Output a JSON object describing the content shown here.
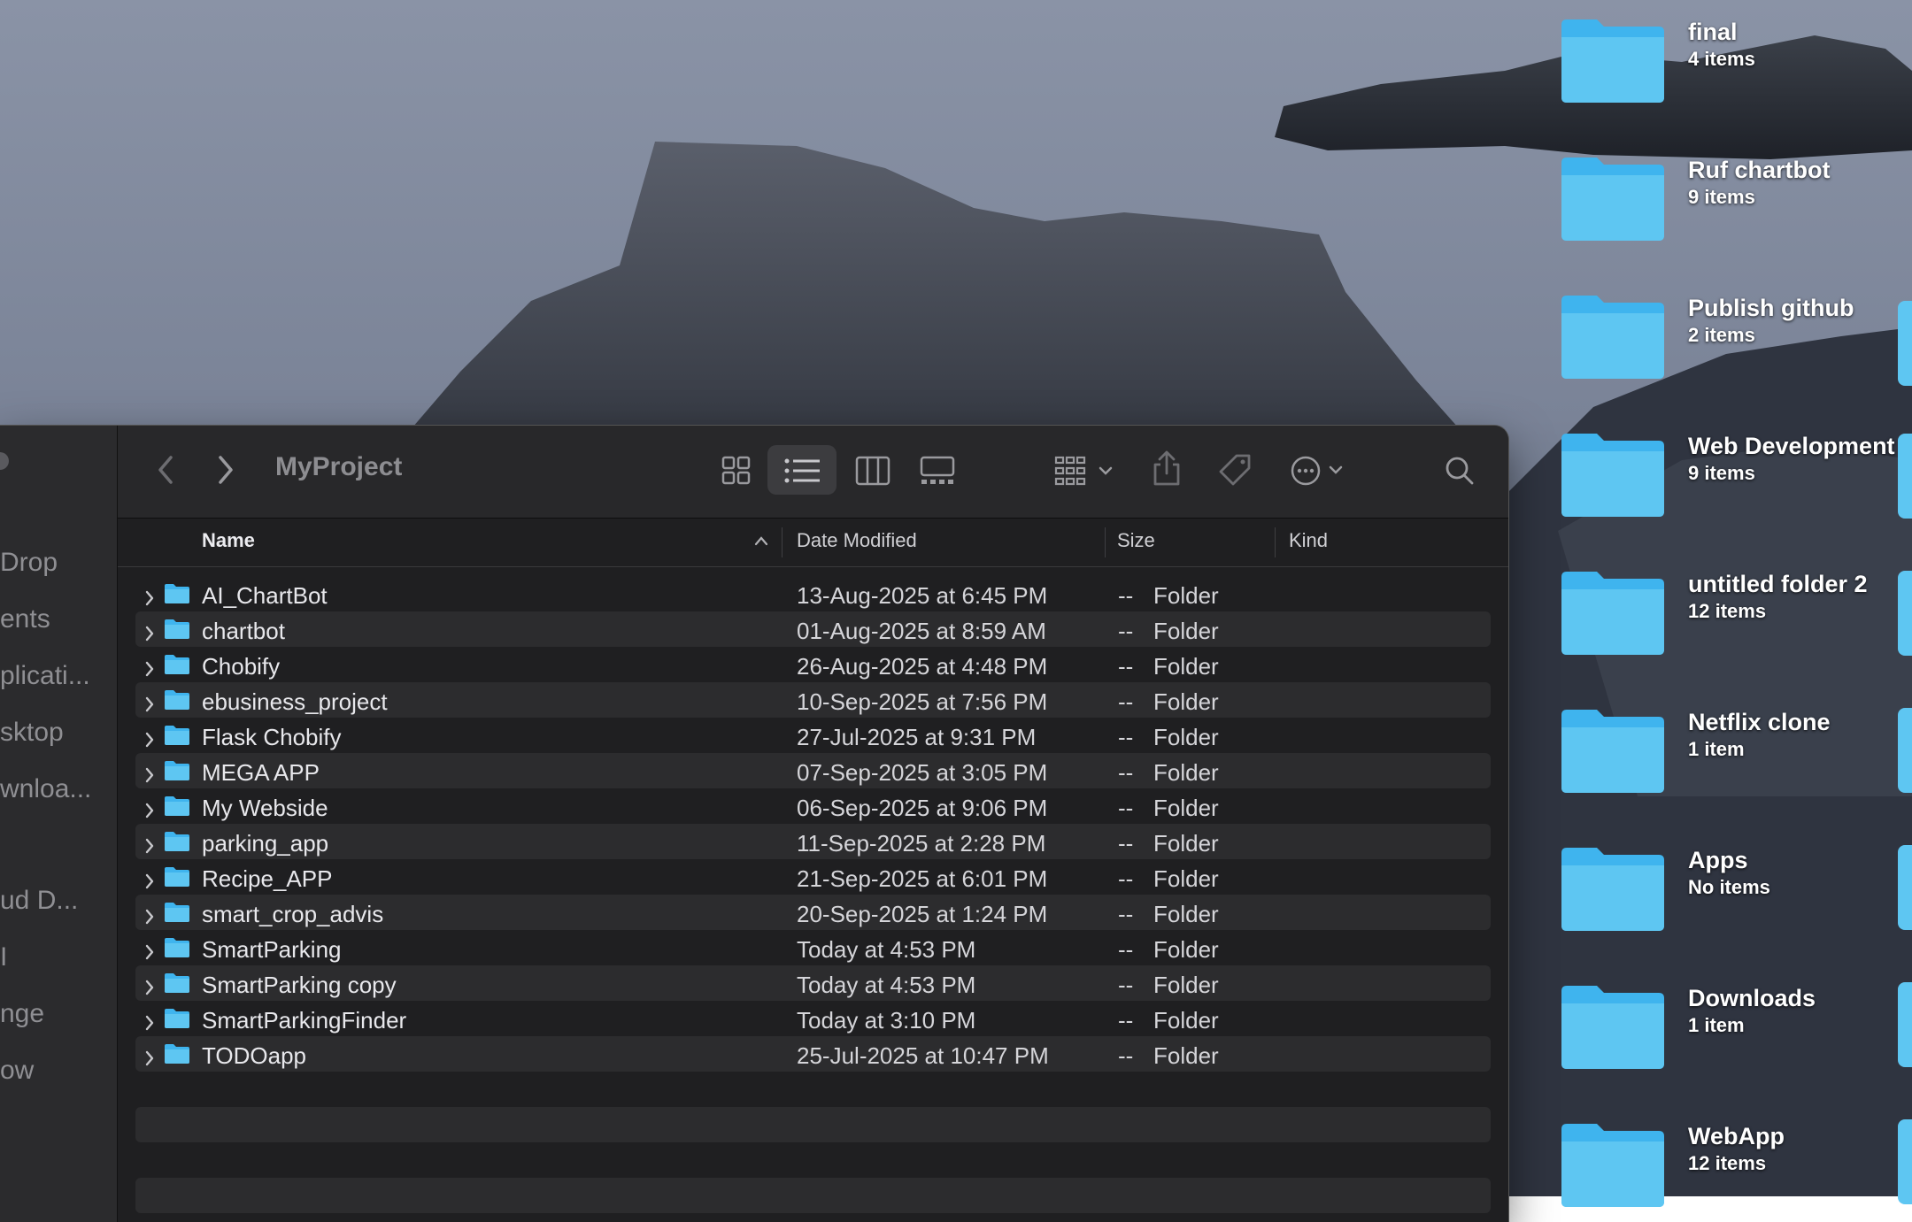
{
  "finder": {
    "title": "MyProject",
    "sidebar_items": [
      "Drop",
      "ents",
      "plicati...",
      "sktop",
      "wnloa...",
      "ud D...",
      "I",
      "nge",
      "ow"
    ],
    "columns": {
      "name": "Name",
      "date": "Date Modified",
      "size": "Size",
      "kind": "Kind"
    },
    "rows": [
      {
        "name": "AI_ChartBot",
        "date": "13-Aug-2025 at 6:45 PM",
        "size": "--",
        "kind": "Folder"
      },
      {
        "name": "chartbot",
        "date": "01-Aug-2025 at 8:59 AM",
        "size": "--",
        "kind": "Folder"
      },
      {
        "name": "Chobify",
        "date": "26-Aug-2025 at 4:48 PM",
        "size": "--",
        "kind": "Folder"
      },
      {
        "name": "ebusiness_project",
        "date": "10-Sep-2025 at 7:56 PM",
        "size": "--",
        "kind": "Folder"
      },
      {
        "name": "Flask Chobify",
        "date": "27-Jul-2025 at 9:31 PM",
        "size": "--",
        "kind": "Folder"
      },
      {
        "name": "MEGA APP",
        "date": "07-Sep-2025 at 3:05 PM",
        "size": "--",
        "kind": "Folder"
      },
      {
        "name": "My Webside",
        "date": "06-Sep-2025 at 9:06 PM",
        "size": "--",
        "kind": "Folder"
      },
      {
        "name": "parking_app",
        "date": "11-Sep-2025 at 2:28 PM",
        "size": "--",
        "kind": "Folder"
      },
      {
        "name": "Recipe_APP",
        "date": "21-Sep-2025 at 6:01 PM",
        "size": "--",
        "kind": "Folder"
      },
      {
        "name": "smart_crop_advis",
        "date": "20-Sep-2025 at 1:24 PM",
        "size": "--",
        "kind": "Folder"
      },
      {
        "name": "SmartParking",
        "date": "Today at 4:53 PM",
        "size": "--",
        "kind": "Folder"
      },
      {
        "name": "SmartParking copy",
        "date": "Today at 4:53 PM",
        "size": "--",
        "kind": "Folder"
      },
      {
        "name": "SmartParkingFinder",
        "date": "Today at 3:10 PM",
        "size": "--",
        "kind": "Folder"
      },
      {
        "name": "TODOapp",
        "date": "25-Jul-2025 at 10:47 PM",
        "size": "--",
        "kind": "Folder"
      }
    ]
  },
  "desktop_items": [
    {
      "name": "final",
      "count": "4 items"
    },
    {
      "name": "Ruf chartbot",
      "count": "9 items"
    },
    {
      "name": "Publish github",
      "count": "2 items"
    },
    {
      "name": "Web Development",
      "count": "9 items"
    },
    {
      "name": "untitled folder 2",
      "count": "12 items"
    },
    {
      "name": "Netflix clone",
      "count": "1 item"
    },
    {
      "name": "Apps",
      "count": "No items"
    },
    {
      "name": "Downloads",
      "count": "1 item"
    },
    {
      "name": "WebApp",
      "count": "12 items"
    }
  ],
  "colors": {
    "folder_blue": "#5ec6f2",
    "window_bg": "#1f1f21",
    "toolbar_bg": "#28282a"
  }
}
